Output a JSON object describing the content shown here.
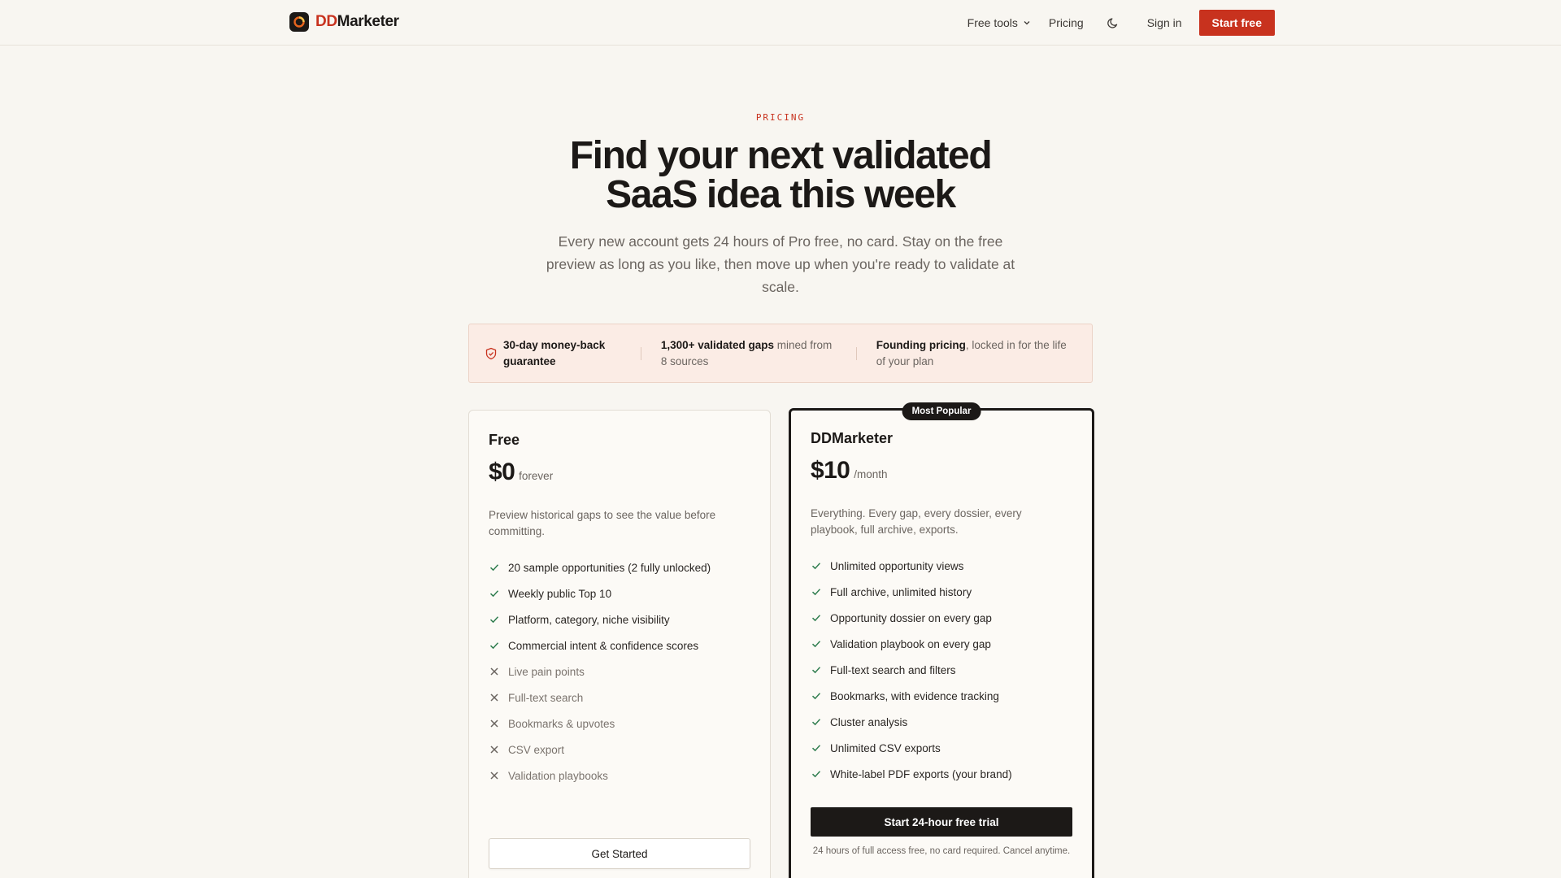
{
  "brand": {
    "prefix": "DD",
    "suffix": "Marketer"
  },
  "nav": {
    "free_tools": "Free tools",
    "pricing": "Pricing",
    "sign_in": "Sign in",
    "start_free": "Start free"
  },
  "hero": {
    "eyebrow": "PRICING",
    "title_line1": "Find your next validated",
    "title_line2": "SaaS idea this week",
    "subtitle": "Every new account gets 24 hours of Pro free, no card. Stay on the free preview as long as you like, then move up when you're ready to validate at scale."
  },
  "trust": [
    {
      "bold": "30-day money-back guarantee",
      "rest": ""
    },
    {
      "bold": "1,300+ validated gaps",
      "rest": " mined from 8 sources"
    },
    {
      "bold": "Founding pricing",
      "rest": ", locked in for the life of your plan"
    }
  ],
  "plans": {
    "free": {
      "name": "Free",
      "price": "$0",
      "period": "forever",
      "description": "Preview historical gaps to see the value before committing.",
      "features": [
        {
          "label": "20 sample opportunities (2 fully unlocked)",
          "included": true
        },
        {
          "label": "Weekly public Top 10",
          "included": true
        },
        {
          "label": "Platform, category, niche visibility",
          "included": true
        },
        {
          "label": "Commercial intent & confidence scores",
          "included": true
        },
        {
          "label": "Live pain points",
          "included": false
        },
        {
          "label": "Full-text search",
          "included": false
        },
        {
          "label": "Bookmarks & upvotes",
          "included": false
        },
        {
          "label": "CSV export",
          "included": false
        },
        {
          "label": "Validation playbooks",
          "included": false
        }
      ],
      "cta": "Get Started"
    },
    "pro": {
      "badge": "Most Popular",
      "name": "DDMarketer",
      "price": "$10",
      "period": "/month",
      "description": "Everything. Every gap, every dossier, every playbook, full archive, exports.",
      "features": [
        {
          "label": "Unlimited opportunity views",
          "included": true
        },
        {
          "label": "Full archive, unlimited history",
          "included": true
        },
        {
          "label": "Opportunity dossier on every gap",
          "included": true
        },
        {
          "label": "Validation playbook on every gap",
          "included": true
        },
        {
          "label": "Full-text search and filters",
          "included": true
        },
        {
          "label": "Bookmarks, with evidence tracking",
          "included": true
        },
        {
          "label": "Cluster analysis",
          "included": true
        },
        {
          "label": "Unlimited CSV exports",
          "included": true
        },
        {
          "label": "White-label PDF exports (your brand)",
          "included": true
        }
      ],
      "cta": "Start 24-hour free trial",
      "cta_note": "24 hours of full access free, no card required. Cancel anytime."
    }
  },
  "icons": {
    "logo": "logo-ring-icon",
    "dropdown": "chevron-down-icon",
    "theme": "moon-icon",
    "guarantee": "shield-check-icon",
    "included": "check-icon",
    "excluded": "x-icon"
  },
  "colors": {
    "accent": "#c8321e",
    "background": "#f8f6f1",
    "ink": "#1c1917",
    "check": "#2f7d4f",
    "trust_bg": "#fbece5"
  }
}
